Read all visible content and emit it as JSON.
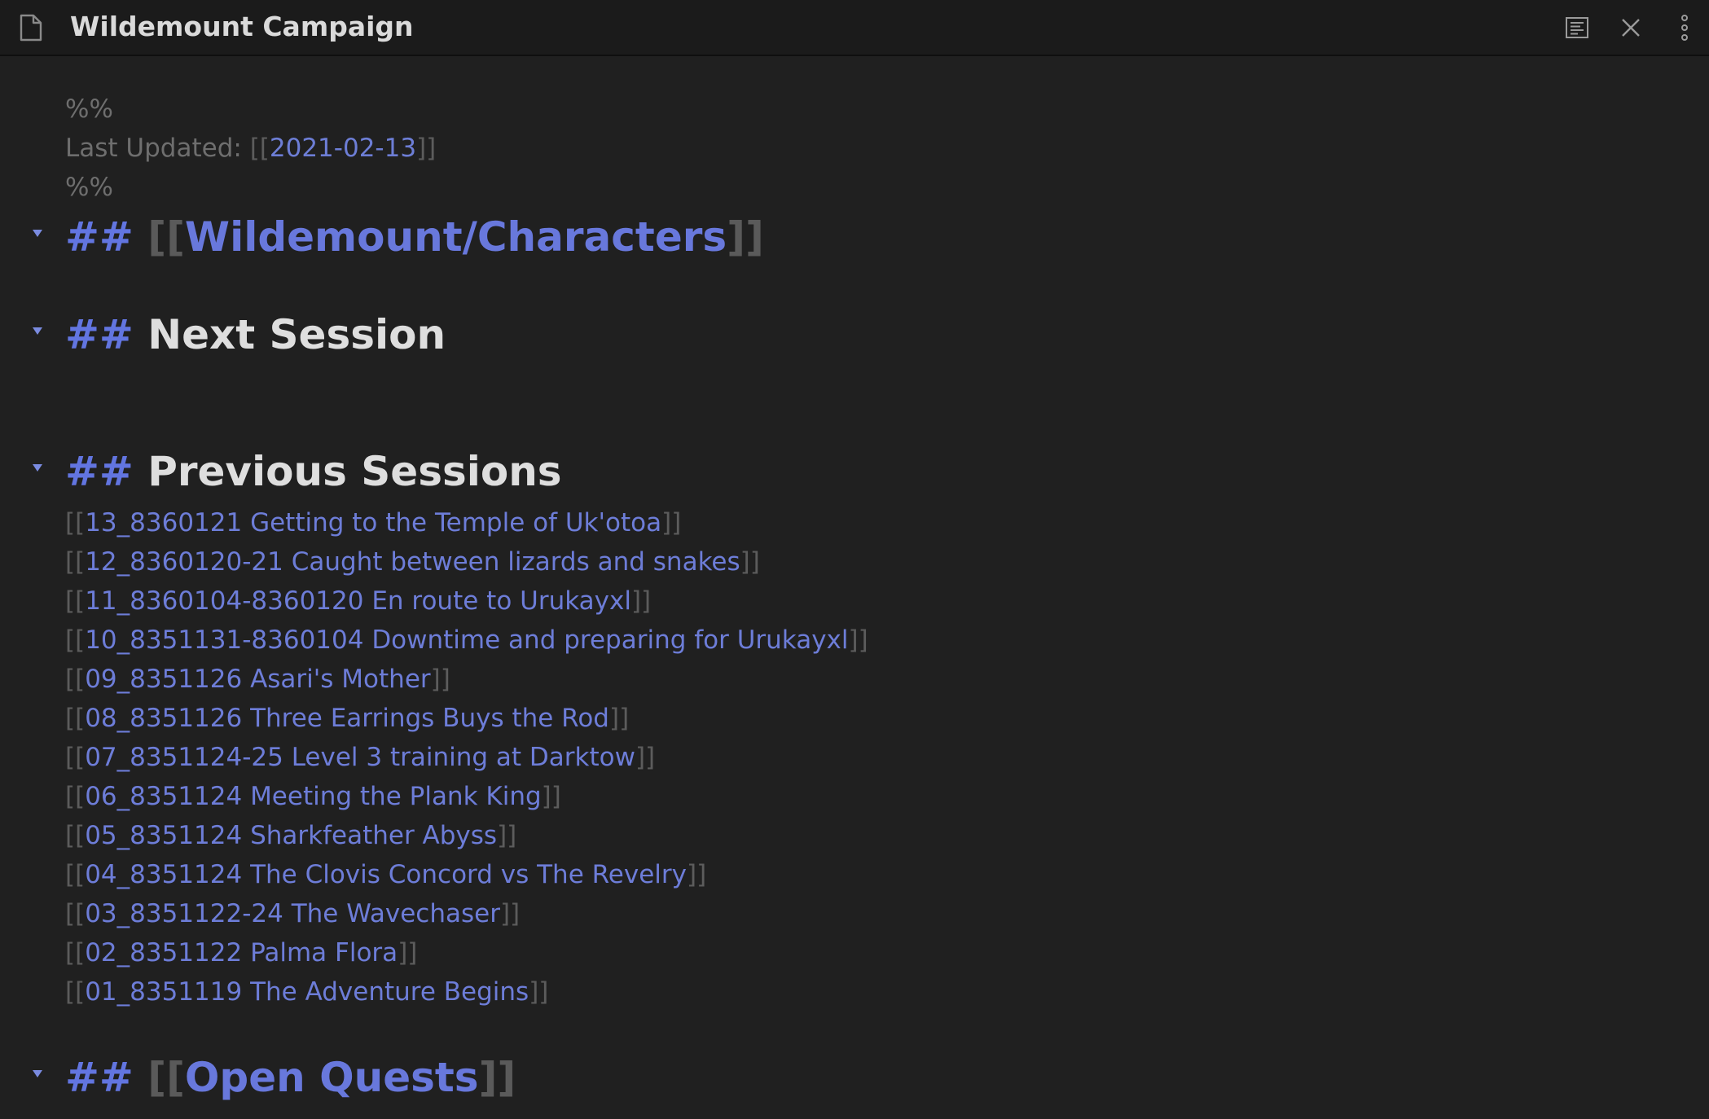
{
  "window": {
    "title": "Wildemount Campaign"
  },
  "toolbar": {
    "reading_view_icon": "reading-view-icon",
    "close_icon": "close-icon",
    "more_icon": "more-options-icon"
  },
  "colors": {
    "background": "#202020",
    "titlebar": "#1b1b1b",
    "link": "#6d7dd8",
    "heading_hash": "#6275e0",
    "heading_text": "#dedede",
    "muted": "#6e6e6e"
  },
  "frontmatter": {
    "open_marker": "%%",
    "last_updated_label": "Last Updated: ",
    "last_updated_open": "[[",
    "last_updated_value": "2021-02-13",
    "last_updated_close": "]]",
    "close_marker": "%%"
  },
  "headings": {
    "characters": {
      "hashes": "##",
      "open": "[[",
      "text": "Wildemount/Characters",
      "close": "]]"
    },
    "next_session": {
      "hashes": "##",
      "text": "Next Session"
    },
    "previous_sessions": {
      "hashes": "##",
      "text": "Previous Sessions"
    },
    "open_quests": {
      "hashes": "##",
      "open": "[[",
      "text": "Open Quests",
      "close": "]]"
    }
  },
  "link_brackets": {
    "open": "[[",
    "close": "]]"
  },
  "sessions": [
    "13_8360121 Getting to the Temple of Uk'otoa",
    "12_8360120-21 Caught between lizards and snakes",
    "11_8360104-8360120 En route to Urukayxl",
    "10_8351131-8360104 Downtime and preparing for Urukayxl",
    "09_8351126 Asari's Mother",
    "08_8351126 Three Earrings Buys the Rod",
    "07_8351124-25 Level 3 training at Darktow",
    "06_8351124 Meeting the Plank King",
    "05_8351124 Sharkfeather Abyss",
    "04_8351124 The Clovis Concord vs The Revelry",
    "03_8351122-24 The Wavechaser",
    "02_8351122 Palma Flora",
    "01_8351119 The Adventure Begins"
  ]
}
